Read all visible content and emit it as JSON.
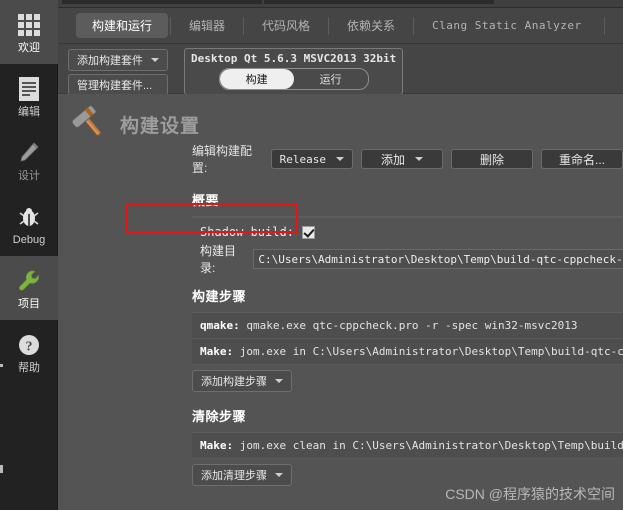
{
  "modebar": {
    "items": [
      {
        "label": "欢迎",
        "icon": "grid-icon",
        "active": true,
        "dim": false
      },
      {
        "label": "编辑",
        "icon": "document-icon",
        "active": false,
        "dim": false
      },
      {
        "label": "设计",
        "icon": "pencil-icon",
        "active": false,
        "dim": true
      },
      {
        "label": "Debug",
        "icon": "bug-icon",
        "active": false,
        "dim": false
      },
      {
        "label": "项目",
        "icon": "wrench-icon",
        "active": true,
        "dim": false
      },
      {
        "label": "帮助",
        "icon": "question-icon",
        "active": false,
        "dim": false
      }
    ]
  },
  "category_tabs": [
    {
      "label": "构建和运行",
      "active": true
    },
    {
      "label": "编辑器",
      "active": false
    },
    {
      "label": "代码风格",
      "active": false
    },
    {
      "label": "依赖关系",
      "active": false
    },
    {
      "label": "Clang Static Analyzer",
      "active": false
    }
  ],
  "kit_bar": {
    "add_kit_button": "添加构建套件",
    "manage_kits_button": "管理构建套件...",
    "kit_name": "Desktop Qt 5.6.3 MSVC2013 32bit",
    "toggle": {
      "build": "构建",
      "run": "运行",
      "selected": "构建"
    }
  },
  "build_settings": {
    "page_title": "构建设置",
    "edit_config_label": "编辑构建配置:",
    "config_value": "Release",
    "add_button": "添加",
    "remove_button": "删除",
    "rename_button": "重命名..."
  },
  "overview": {
    "title": "概要",
    "shadow_build_label": "Shadow build:",
    "shadow_build_checked": true,
    "build_dir_label": "构建目录:",
    "build_dir_value": "C:\\Users\\Administrator\\Desktop\\Temp\\build-qtc-cppcheck-Desktop_Qt"
  },
  "build_steps": {
    "title": "构建步骤",
    "steps": [
      {
        "name": "qmake:",
        "detail": " qmake.exe qtc-cppcheck.pro -r -spec win32-msvc2013"
      },
      {
        "name": "Make:",
        "detail": " jom.exe in C:\\Users\\Administrator\\Desktop\\Temp\\build-qtc-cppcheck-Desktop"
      }
    ],
    "add_step_button": "添加构建步骤"
  },
  "clean_steps": {
    "title": "清除步骤",
    "steps": [
      {
        "name": "Make:",
        "detail": " jom.exe clean in C:\\Users\\Administrator\\Desktop\\Temp\\build-qtc-cppcheck-D"
      }
    ],
    "add_step_button": "添加清理步骤"
  },
  "watermark": "CSDN @程序猿的技术空间",
  "colors": {
    "accent_red": "#ee1111",
    "panel_bg": "#4e4e4e",
    "main_bg": "#545454",
    "modebar_bg": "#222222",
    "wrench_green": "#7cb342"
  }
}
